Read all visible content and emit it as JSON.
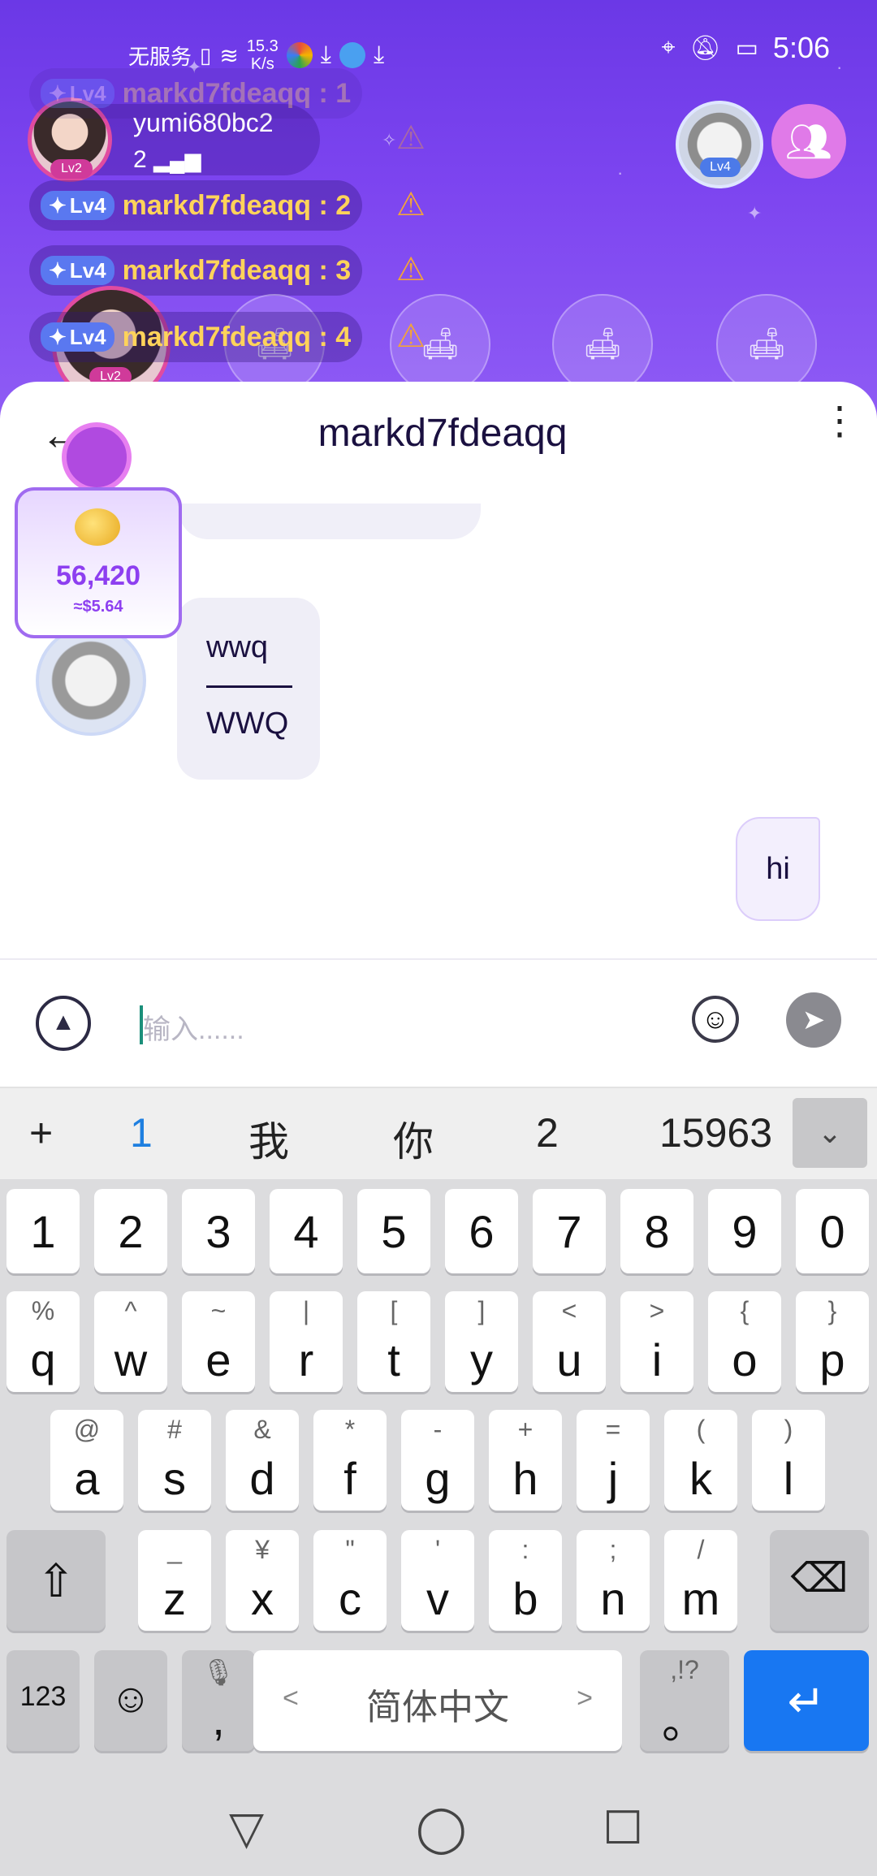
{
  "status_bar": {
    "carrier": "无服务",
    "speed_value": "15.3",
    "speed_unit": "K/s",
    "time": "5:06"
  },
  "room": {
    "host_name": "yumi680bc2",
    "host_level": "Lv2",
    "host_count": "2",
    "messages": [
      {
        "level": "Lv4",
        "text": "markd7fdeaqq : 1"
      },
      {
        "level": "Lv4",
        "text": "markd7fdeaqq : 2"
      },
      {
        "level": "Lv4",
        "text": "markd7fdeaqq : 3"
      },
      {
        "level": "Lv4",
        "text": "markd7fdeaqq : 4"
      }
    ],
    "guest_level": "Lv4",
    "overlay_level": "Lv2"
  },
  "chat": {
    "title": "markd7fdeaqq",
    "messages": [
      {
        "side": "left",
        "line1": "wwq",
        "line2": "WWQ"
      },
      {
        "side": "right",
        "text": "hi"
      }
    ]
  },
  "gift": {
    "amount": "56,420",
    "usd": "≈$5.64"
  },
  "input": {
    "placeholder": "输入......"
  },
  "ime": {
    "suggestions": [
      "+",
      "1",
      "我",
      "你",
      "2",
      "15963"
    ],
    "number_row": [
      "1",
      "2",
      "3",
      "4",
      "5",
      "6",
      "7",
      "8",
      "9",
      "0"
    ],
    "row1": [
      {
        "main": "q",
        "sub": "%"
      },
      {
        "main": "w",
        "sub": "^"
      },
      {
        "main": "e",
        "sub": "~"
      },
      {
        "main": "r",
        "sub": "|"
      },
      {
        "main": "t",
        "sub": "["
      },
      {
        "main": "y",
        "sub": "]"
      },
      {
        "main": "u",
        "sub": "<"
      },
      {
        "main": "i",
        "sub": ">"
      },
      {
        "main": "o",
        "sub": "{"
      },
      {
        "main": "p",
        "sub": "}"
      }
    ],
    "row2": [
      {
        "main": "a",
        "sub": "@"
      },
      {
        "main": "s",
        "sub": "#"
      },
      {
        "main": "d",
        "sub": "&"
      },
      {
        "main": "f",
        "sub": "*"
      },
      {
        "main": "g",
        "sub": "-"
      },
      {
        "main": "h",
        "sub": "+"
      },
      {
        "main": "j",
        "sub": "="
      },
      {
        "main": "k",
        "sub": "("
      },
      {
        "main": "l",
        "sub": ")"
      }
    ],
    "row3": [
      {
        "main": "z",
        "sub": "_"
      },
      {
        "main": "x",
        "sub": "¥"
      },
      {
        "main": "c",
        "sub": "\""
      },
      {
        "main": "v",
        "sub": "'"
      },
      {
        "main": "b",
        "sub": ":"
      },
      {
        "main": "n",
        "sub": ";"
      },
      {
        "main": "m",
        "sub": "/"
      }
    ],
    "num_key": "123",
    "comma": ",",
    "space_label": "简体中文",
    "space_left": "<",
    "space_right": ">",
    "punct_sub": ",!?",
    "punct_main": "。"
  },
  "icons": {
    "back": "arrow-left-icon",
    "more": "more-vertical-icon",
    "send": "send-icon",
    "emoji": "emoji-icon",
    "expand": "chevron-up-icon"
  }
}
